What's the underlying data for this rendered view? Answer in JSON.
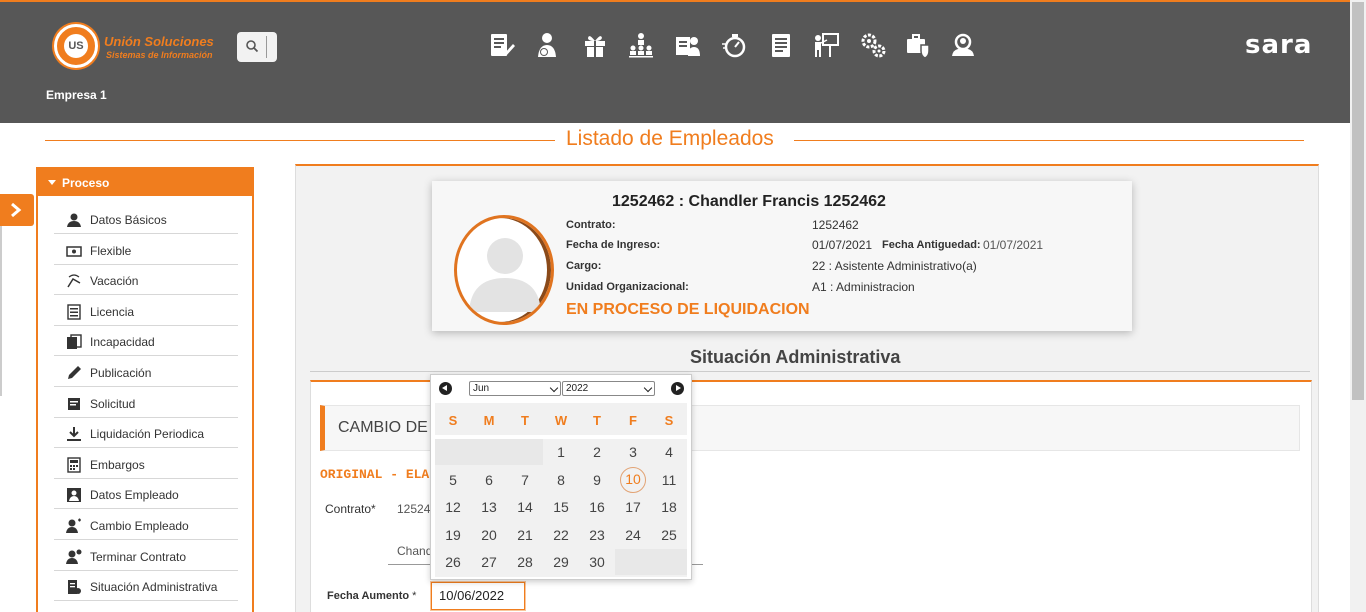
{
  "header": {
    "logo_line1": "Unión Soluciones",
    "logo_line2": "Sistemas de Información",
    "logo_mark": "UNION US",
    "brand": "sara",
    "empresa": "Empresa 1",
    "modules": [
      "document-edit-icon",
      "person-money-icon",
      "gift-icon",
      "org-chart-icon",
      "id-card-person-icon",
      "stopwatch-icon",
      "report-sheet-icon",
      "presentation-icon",
      "gears-icon",
      "briefcase-shield-icon",
      "person-search-icon"
    ]
  },
  "page": {
    "title": "Listado de Empleados"
  },
  "sidebar": {
    "title": "Proceso",
    "items": [
      {
        "label": "Datos Básicos",
        "icon": "person-icon"
      },
      {
        "label": "Flexible",
        "icon": "money-icon"
      },
      {
        "label": "Vacación",
        "icon": "beach-chair-icon"
      },
      {
        "label": "Licencia",
        "icon": "list-icon"
      },
      {
        "label": "Incapacidad",
        "icon": "medical-docs-icon"
      },
      {
        "label": "Publicación",
        "icon": "pen-icon"
      },
      {
        "label": "Solicitud",
        "icon": "request-icon"
      },
      {
        "label": "Liquidación Periodica",
        "icon": "download-icon"
      },
      {
        "label": "Embargos",
        "icon": "calculator-icon"
      },
      {
        "label": "Datos Empleado",
        "icon": "employee-card-icon"
      },
      {
        "label": "Cambio Empleado",
        "icon": "person-change-icon"
      },
      {
        "label": "Terminar Contrato",
        "icon": "person-remove-icon"
      },
      {
        "label": "Situación Administrativa",
        "icon": "admin-doc-icon"
      }
    ]
  },
  "employee": {
    "name": "1252462 : Chandler Francis 1252462",
    "contrato_label": "Contrato:",
    "contrato": "1252462",
    "ingreso_label": "Fecha de Ingreso:",
    "ingreso": "01/07/2021",
    "antiguedad_label": "Fecha Antiguedad:",
    "antiguedad": "01/07/2021",
    "cargo_label": "Cargo:",
    "cargo": "22 : Asistente Administrativo(a)",
    "unidad_label": "Unidad Organizacional:",
    "unidad": "A1 : Administracion",
    "status": "EN PROCESO DE LIQUIDACION"
  },
  "section": {
    "title": "Situación Administrativa",
    "form_title": "CAMBIO DE",
    "original": "ORIGINAL - ELA",
    "contrato_label": "Contrato",
    "contrato_value": "12524",
    "nombre_value": "Chand",
    "fecha_label": "Fecha Aumento",
    "required": "*",
    "fecha_value": "10/06/2022"
  },
  "datepicker": {
    "month": "Jun",
    "year": "2022",
    "weekdays": [
      "S",
      "M",
      "T",
      "W",
      "T",
      "F",
      "S"
    ],
    "days": [
      "1",
      "2",
      "3",
      "4",
      "5",
      "6",
      "7",
      "8",
      "9",
      "10",
      "11",
      "12",
      "13",
      "14",
      "15",
      "16",
      "17",
      "18",
      "19",
      "20",
      "21",
      "22",
      "23",
      "24",
      "25",
      "26",
      "27",
      "28",
      "29",
      "30"
    ],
    "highlighted_day": "10"
  },
  "colors": {
    "accent": "#f07d1e",
    "header_bg": "#575757"
  }
}
